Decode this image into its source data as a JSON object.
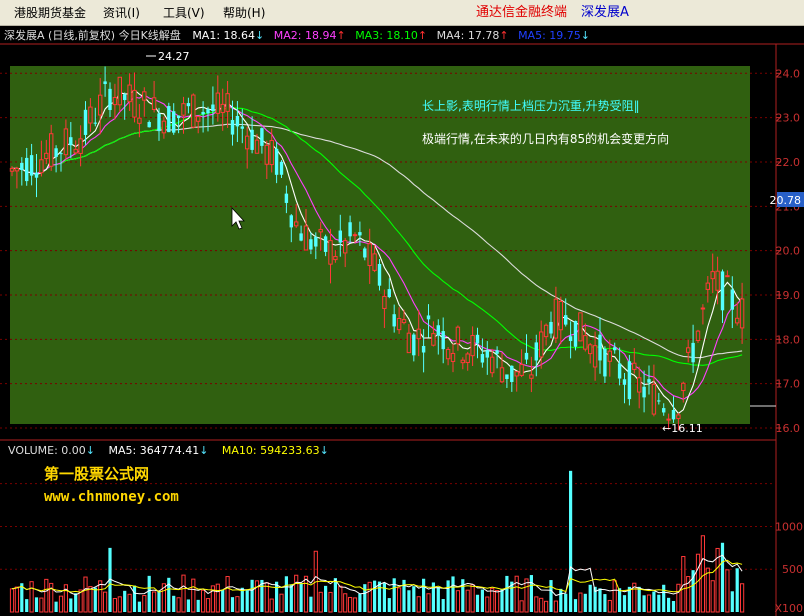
{
  "menubar": {
    "items": [
      "港股期货基金",
      "资讯(I)",
      "工具(V)",
      "帮助(H)"
    ],
    "app_title": "通达信金融终端",
    "stock_tag": "深发展A"
  },
  "chart_header": {
    "stock_label": "深发展A (日线,前复权) 今日K线解盘",
    "ma": [
      {
        "label": "MA1: 18.64",
        "dir": "down",
        "color": "#ffffff"
      },
      {
        "label": "MA2: 18.94",
        "dir": "up",
        "color": "#ff40ff"
      },
      {
        "label": "MA3: 18.10",
        "dir": "up",
        "color": "#00ff00"
      },
      {
        "label": "MA4: 17.78",
        "dir": "up",
        "color": "#dcdcdc"
      },
      {
        "label": "MA5: 19.75",
        "dir": "down",
        "color": "#2040ff"
      }
    ],
    "arrow_up": "↑",
    "arrow_down": "↓"
  },
  "annotations": {
    "line1": "长上影,表明行情上档压力沉重,升势受阻‖",
    "line2": "极端行情,在未来的几日内有85的机会变更方向",
    "high_label": "24.27",
    "low_label": "←16.11"
  },
  "price_axis": {
    "ticks": [
      "24.0",
      "23.0",
      "22.0",
      "21.0",
      "20.0",
      "19.0",
      "18.0",
      "17.0",
      "16.0"
    ],
    "current_price": "20.78"
  },
  "volume_header": {
    "items": [
      {
        "label": "VOLUME: 0.00",
        "dir": "down"
      },
      {
        "label": "MA5: 364774.41",
        "dir": "down"
      },
      {
        "label": "MA10: 594233.63",
        "dir": "down"
      }
    ]
  },
  "volume_axis": {
    "ticks": [
      "1000",
      "500"
    ],
    "unit": "X100"
  },
  "watermark": {
    "name": "第一股票公式网",
    "url": "www.chnmoney.com"
  },
  "colors": {
    "background": "#000000",
    "panel_green": "#306010",
    "candle_up": "#ff3838",
    "candle_down": "#54ffff",
    "ma1": "#ffffff",
    "ma2": "#ff40ff",
    "ma3": "#00ff00",
    "ma4": "#dcdcdc",
    "grid": "#7a0000",
    "annotation_text": "#40ffff"
  },
  "chart_data": {
    "type": "candlestick",
    "price_ylim": [
      16.0,
      24.3
    ],
    "volume_ylim": [
      0,
      1800
    ],
    "high": 24.27,
    "low": 16.11,
    "trend_points": [
      [
        0,
        21.8
      ],
      [
        8,
        22.2
      ],
      [
        14,
        22.6
      ],
      [
        20,
        23.6
      ],
      [
        26,
        23.3
      ],
      [
        32,
        23.0
      ],
      [
        38,
        23.2
      ],
      [
        44,
        23.1
      ],
      [
        48,
        22.7
      ],
      [
        54,
        22.0
      ],
      [
        58,
        20.6
      ],
      [
        62,
        20.1
      ],
      [
        66,
        20.0
      ],
      [
        70,
        20.3
      ],
      [
        74,
        19.6
      ],
      [
        78,
        18.6
      ],
      [
        82,
        18.0
      ],
      [
        86,
        18.3
      ],
      [
        90,
        17.9
      ],
      [
        94,
        17.8
      ],
      [
        98,
        17.6
      ],
      [
        102,
        17.2
      ],
      [
        106,
        17.3
      ],
      [
        110,
        18.5
      ],
      [
        114,
        18.4
      ],
      [
        118,
        17.9
      ],
      [
        122,
        17.5
      ],
      [
        126,
        17.1
      ],
      [
        130,
        16.8
      ],
      [
        134,
        16.5
      ],
      [
        136,
        16.6
      ],
      [
        140,
        18.2
      ],
      [
        143,
        19.3
      ],
      [
        146,
        19.0
      ],
      [
        149,
        18.6
      ]
    ],
    "ma_spans": {
      "ma1": 5,
      "ma2": 10,
      "ma3": 30,
      "ma4": 60
    }
  }
}
